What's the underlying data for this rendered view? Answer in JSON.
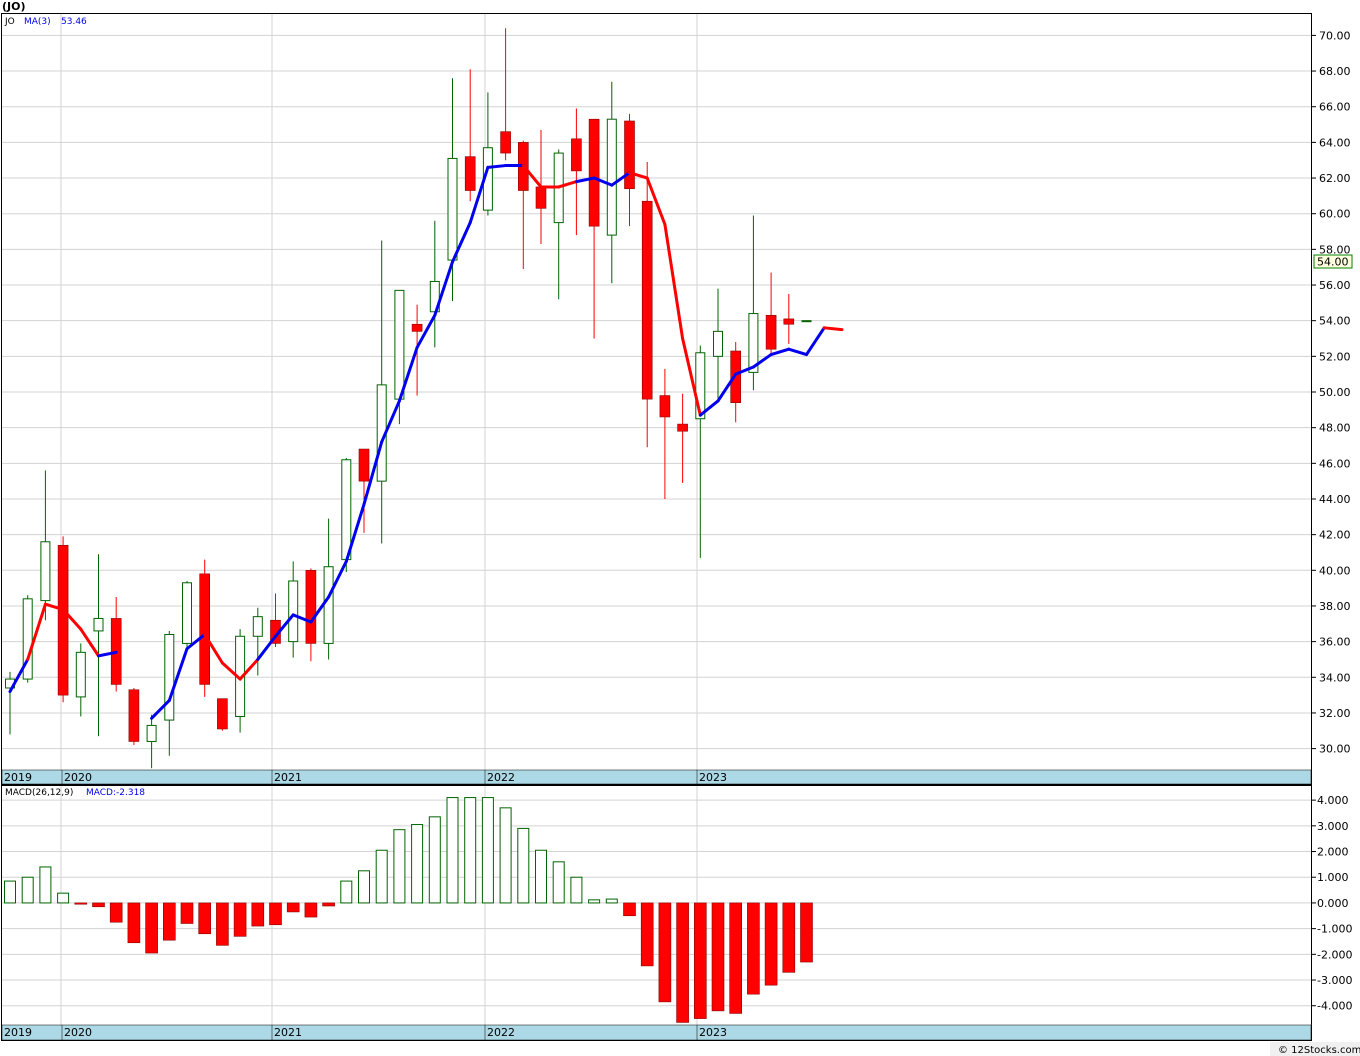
{
  "title": "(JO)",
  "price_legend": {
    "symbol": "JO",
    "ma_label": "MA(3)",
    "ma_value": "53.46"
  },
  "macd_legend": {
    "label": "MACD(26,12,9)",
    "value": "MACD:-2.318"
  },
  "last_price_label": "54.00",
  "credit": "© 12Stocks.com",
  "colors": {
    "up": "#006400",
    "down": "#ff0000",
    "ma_up": "#0000ee",
    "ma_down": "#ff0000",
    "axis_band": "#add8e6",
    "grid": "#d3d3d3"
  },
  "chart_data": [
    {
      "type": "candlestick",
      "name": "price",
      "x_axis_labels": [
        "2019",
        "2020",
        "2021",
        "2022",
        "2023"
      ],
      "y_ticks": [
        "30.00",
        "32.00",
        "34.00",
        "36.00",
        "38.00",
        "40.00",
        "42.00",
        "44.00",
        "46.00",
        "48.00",
        "50.00",
        "52.00",
        "54.00",
        "56.00",
        "58.00",
        "60.00",
        "62.00",
        "64.00",
        "66.00",
        "68.00",
        "70.00"
      ],
      "ylim": [
        28.8,
        71.2
      ],
      "grid": true,
      "candles": [
        {
          "o": 33.4,
          "h": 34.3,
          "l": 30.8,
          "c": 33.9
        },
        {
          "o": 33.9,
          "h": 38.6,
          "l": 33.7,
          "c": 38.4
        },
        {
          "o": 38.3,
          "h": 45.6,
          "l": 37.2,
          "c": 41.6
        },
        {
          "o": 41.4,
          "h": 41.9,
          "l": 32.6,
          "c": 33.0
        },
        {
          "o": 32.9,
          "h": 35.9,
          "l": 31.8,
          "c": 35.4
        },
        {
          "o": 36.6,
          "h": 40.9,
          "l": 30.7,
          "c": 37.3
        },
        {
          "o": 37.3,
          "h": 38.5,
          "l": 33.2,
          "c": 33.6
        },
        {
          "o": 33.3,
          "h": 33.4,
          "l": 30.2,
          "c": 30.4
        },
        {
          "o": 30.4,
          "h": 31.9,
          "l": 28.9,
          "c": 31.3
        },
        {
          "o": 31.6,
          "h": 36.6,
          "l": 29.6,
          "c": 36.4
        },
        {
          "o": 35.9,
          "h": 39.4,
          "l": 35.5,
          "c": 39.3
        },
        {
          "o": 39.8,
          "h": 40.6,
          "l": 32.9,
          "c": 33.6
        },
        {
          "o": 32.8,
          "h": 32.6,
          "l": 31.0,
          "c": 31.1
        },
        {
          "o": 31.8,
          "h": 36.7,
          "l": 30.9,
          "c": 36.3
        },
        {
          "o": 36.3,
          "h": 37.9,
          "l": 34.1,
          "c": 37.4
        },
        {
          "o": 37.2,
          "h": 38.7,
          "l": 35.7,
          "c": 35.9
        },
        {
          "o": 36.0,
          "h": 40.5,
          "l": 35.1,
          "c": 39.4
        },
        {
          "o": 40.0,
          "h": 40.1,
          "l": 34.9,
          "c": 35.9
        },
        {
          "o": 35.9,
          "h": 42.9,
          "l": 35.0,
          "c": 40.2
        },
        {
          "o": 40.6,
          "h": 46.3,
          "l": 39.9,
          "c": 46.2
        },
        {
          "o": 46.8,
          "h": 46.6,
          "l": 42.1,
          "c": 45.0
        },
        {
          "o": 45.0,
          "h": 58.5,
          "l": 41.5,
          "c": 50.4
        },
        {
          "o": 49.6,
          "h": 55.1,
          "l": 48.2,
          "c": 55.7
        },
        {
          "o": 53.8,
          "h": 54.9,
          "l": 49.8,
          "c": 53.4
        },
        {
          "o": 54.5,
          "h": 59.6,
          "l": 52.5,
          "c": 56.2
        },
        {
          "o": 57.4,
          "h": 67.6,
          "l": 55.1,
          "c": 63.1
        },
        {
          "o": 63.2,
          "h": 68.1,
          "l": 60.7,
          "c": 61.3
        },
        {
          "o": 60.2,
          "h": 66.8,
          "l": 59.9,
          "c": 63.7
        },
        {
          "o": 64.6,
          "h": 70.4,
          "l": 63.0,
          "c": 63.4
        },
        {
          "o": 64.0,
          "h": 64.1,
          "l": 56.9,
          "c": 61.3
        },
        {
          "o": 61.5,
          "h": 64.7,
          "l": 58.3,
          "c": 60.3
        },
        {
          "o": 59.5,
          "h": 63.6,
          "l": 55.2,
          "c": 63.4
        },
        {
          "o": 64.2,
          "h": 65.9,
          "l": 58.8,
          "c": 62.4
        },
        {
          "o": 65.3,
          "h": 65.0,
          "l": 53.0,
          "c": 59.3
        },
        {
          "o": 58.8,
          "h": 67.4,
          "l": 56.1,
          "c": 65.3
        },
        {
          "o": 65.2,
          "h": 65.6,
          "l": 59.3,
          "c": 61.4
        },
        {
          "o": 60.7,
          "h": 62.9,
          "l": 46.9,
          "c": 49.6
        },
        {
          "o": 49.8,
          "h": 51.3,
          "l": 44.0,
          "c": 48.6
        },
        {
          "o": 48.2,
          "h": 49.9,
          "l": 44.9,
          "c": 47.8
        },
        {
          "o": 48.5,
          "h": 52.6,
          "l": 40.7,
          "c": 52.2
        },
        {
          "o": 52.0,
          "h": 55.8,
          "l": 49.5,
          "c": 53.4
        },
        {
          "o": 52.3,
          "h": 52.8,
          "l": 48.3,
          "c": 49.4
        },
        {
          "o": 51.1,
          "h": 59.9,
          "l": 50.1,
          "c": 54.4
        },
        {
          "o": 54.3,
          "h": 56.7,
          "l": 52.0,
          "c": 52.4
        },
        {
          "o": 54.1,
          "h": 55.5,
          "l": 52.7,
          "c": 53.8
        },
        {
          "o": 54.0,
          "h": 54.0,
          "l": 54.0,
          "c": 54.0
        }
      ],
      "ma3": [
        33.2,
        35.0,
        38.1,
        37.8,
        36.7,
        35.2,
        35.4,
        null,
        31.7,
        32.7,
        35.6,
        36.4,
        34.8,
        33.9,
        35.0,
        36.3,
        37.5,
        37.1,
        38.5,
        40.5,
        43.7,
        47.2,
        49.5,
        52.5,
        54.3,
        57.3,
        59.5,
        62.6,
        62.7,
        62.7,
        61.5,
        61.5,
        61.8,
        62.0,
        61.6,
        62.3,
        62.0,
        59.4,
        53.0,
        48.7,
        49.5,
        51.0,
        51.4,
        52.1,
        52.4,
        52.1,
        53.6,
        53.5
      ],
      "ma3_colors": [
        "u",
        "u",
        "d",
        "d",
        "d",
        "d",
        "u",
        "g",
        "u",
        "u",
        "u",
        "u",
        "d",
        "d",
        "d",
        "u",
        "u",
        "u",
        "u",
        "u",
        "u",
        "u",
        "u",
        "u",
        "u",
        "u",
        "u",
        "u",
        "u",
        "u",
        "d",
        "d",
        "d",
        "u",
        "u",
        "u",
        "d",
        "d",
        "d",
        "d",
        "u",
        "u",
        "u",
        "u",
        "u",
        "u",
        "u",
        "d"
      ]
    },
    {
      "type": "bar",
      "name": "macd",
      "y_ticks": [
        "-4.000",
        "-3.000",
        "-2.000",
        "-1.000",
        "0.000",
        "1.000",
        "2.000",
        "3.000",
        "4.000"
      ],
      "ylim": [
        -4.75,
        4.55
      ],
      "grid": true,
      "values": [
        0.85,
        1.0,
        1.4,
        0.38,
        -0.05,
        -0.15,
        -0.75,
        -1.55,
        -1.95,
        -1.45,
        -0.8,
        -1.2,
        -1.65,
        -1.3,
        -0.9,
        -0.85,
        -0.35,
        -0.55,
        -0.12,
        0.85,
        1.25,
        2.05,
        2.85,
        3.05,
        3.35,
        4.1,
        4.1,
        4.1,
        3.7,
        2.9,
        2.05,
        1.6,
        1.0,
        0.12,
        0.15,
        -0.5,
        -2.45,
        -3.85,
        -4.65,
        -4.5,
        -4.2,
        -4.3,
        -3.55,
        -3.2,
        -2.7,
        -2.3
      ]
    }
  ]
}
